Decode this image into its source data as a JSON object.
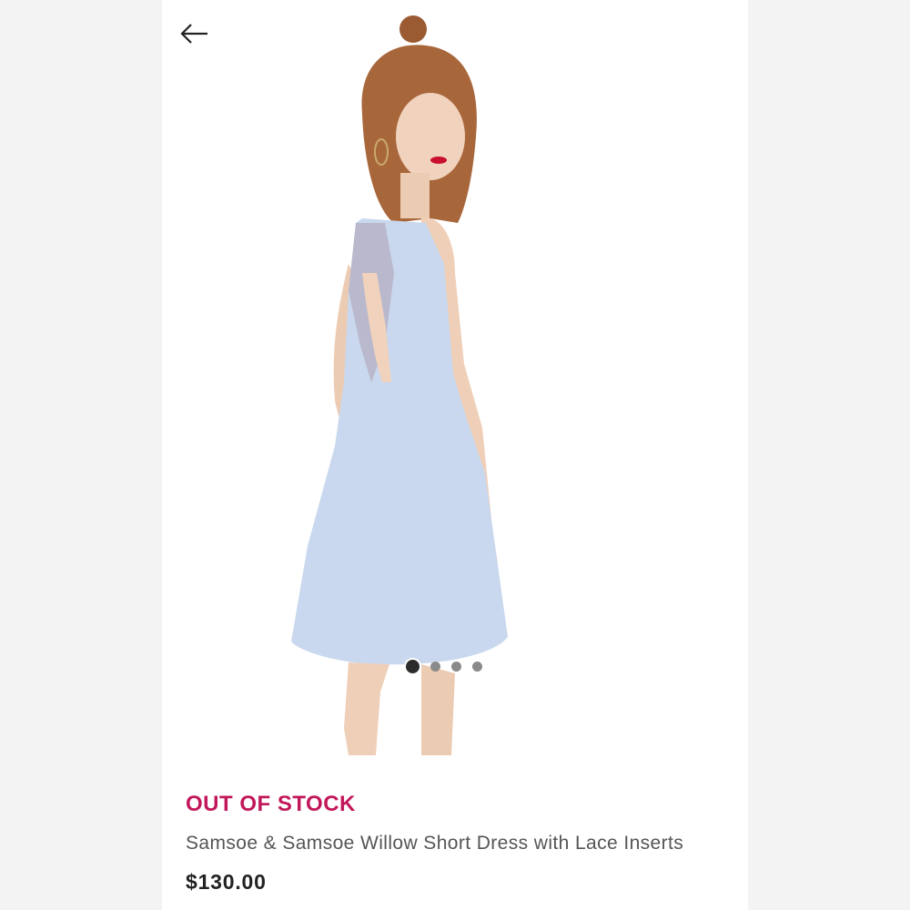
{
  "product": {
    "status": "OUT OF STOCK",
    "name": "Samsoe & Samsoe Willow Short Dress with Lace Inserts",
    "price": "$130.00"
  },
  "gallery": {
    "dots": [
      true,
      false,
      false,
      false
    ]
  },
  "icons": {
    "back": "arrow-left-icon"
  },
  "colors": {
    "status": "#c2185b",
    "dress": "#c9d8ee"
  }
}
